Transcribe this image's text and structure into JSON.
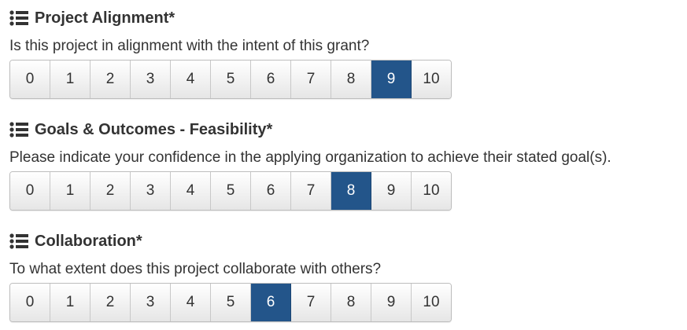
{
  "sections": [
    {
      "title": "Project Alignment*",
      "question": "Is this project in alignment with the intent of this grant?",
      "options": [
        "0",
        "1",
        "2",
        "3",
        "4",
        "5",
        "6",
        "7",
        "8",
        "9",
        "10"
      ],
      "selected": "9"
    },
    {
      "title": "Goals & Outcomes - Feasibility*",
      "question": "Please indicate your confidence in the applying organization to achieve their stated goal(s).",
      "options": [
        "0",
        "1",
        "2",
        "3",
        "4",
        "5",
        "6",
        "7",
        "8",
        "9",
        "10"
      ],
      "selected": "8"
    },
    {
      "title": "Collaboration*",
      "question": "To what extent does this project collaborate with others?",
      "options": [
        "0",
        "1",
        "2",
        "3",
        "4",
        "5",
        "6",
        "7",
        "8",
        "9",
        "10"
      ],
      "selected": "6"
    }
  ],
  "colors": {
    "selected_bg": "#23558a",
    "selected_text": "#ffffff",
    "text": "#333333"
  },
  "icons": {
    "section_icon": "list-icon"
  }
}
